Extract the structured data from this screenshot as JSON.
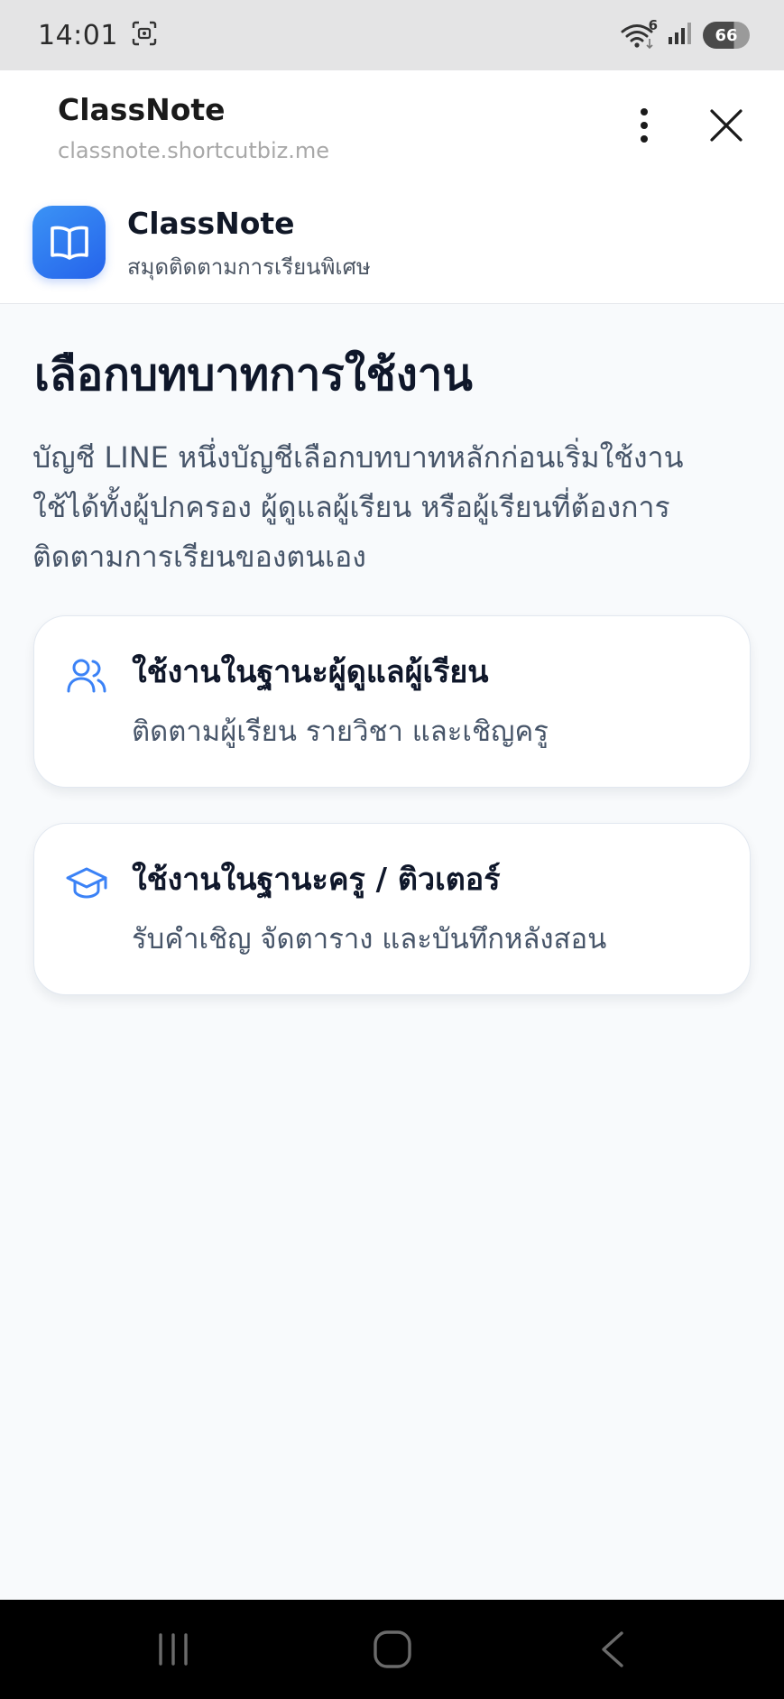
{
  "status_bar": {
    "time": "14:01",
    "wifi_badge": "6",
    "battery_level": "66",
    "icons": [
      "screenshot-icon",
      "wifi-icon",
      "signal-icon",
      "battery-icon"
    ]
  },
  "browser": {
    "title": "ClassNote",
    "url": "classnote.shortcutbiz.me",
    "icons": [
      "kebab-menu-icon",
      "close-icon"
    ]
  },
  "app": {
    "name": "ClassNote",
    "subtitle": "สมุดติดตามการเรียนพิเศษ",
    "logo_icon": "open-book-icon"
  },
  "main": {
    "title": "เลือกบทบาทการใช้งาน",
    "description_lines": [
      "บัญชี LINE หนึ่งบัญชีเลือกบทบาทหลักก่อนเริ่มใช้งาน",
      "ใช้ได้ทั้งผู้ปกครอง ผู้ดูแลผู้เรียน หรือผู้เรียนที่ต้องการ",
      "ติดตามการเรียนของตนเอง"
    ],
    "roles": [
      {
        "icon": "users-icon",
        "title": "ใช้งานในฐานะผู้ดูแลผู้เรียน",
        "description": "ติดตามผู้เรียน รายวิชา และเชิญครู"
      },
      {
        "icon": "graduation-cap-icon",
        "title": "ใช้งานในฐานะครู / ติวเตอร์",
        "description": "รับคำเชิญ จัดตาราง และบันทึกหลังสอน"
      }
    ]
  },
  "nav_bar": {
    "icons": [
      "recents-icon",
      "home-icon",
      "back-icon"
    ]
  },
  "colors": {
    "accent": "#2563eb",
    "role_icon": "#3b82f6",
    "background": "#f8fafc",
    "status_bar": "#e4e4e5"
  }
}
